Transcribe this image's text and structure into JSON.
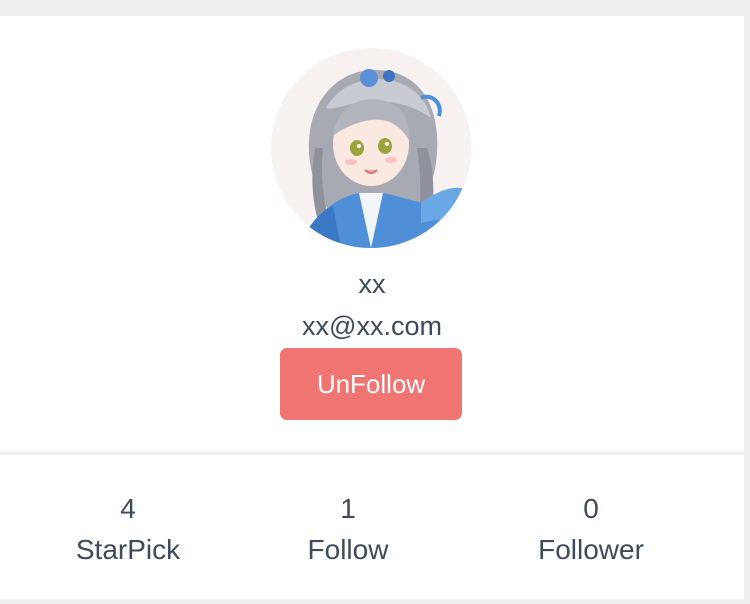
{
  "profile": {
    "name": "xx",
    "email": "xx@xx.com",
    "avatar_icon": "anime-character-avatar",
    "unfollow_label": "UnFollow",
    "button_color": "#f07471"
  },
  "stats": {
    "starpick": {
      "count": "4",
      "label": "StarPick"
    },
    "follow": {
      "count": "1",
      "label": "Follow"
    },
    "follower": {
      "count": "0",
      "label": "Follower"
    }
  }
}
